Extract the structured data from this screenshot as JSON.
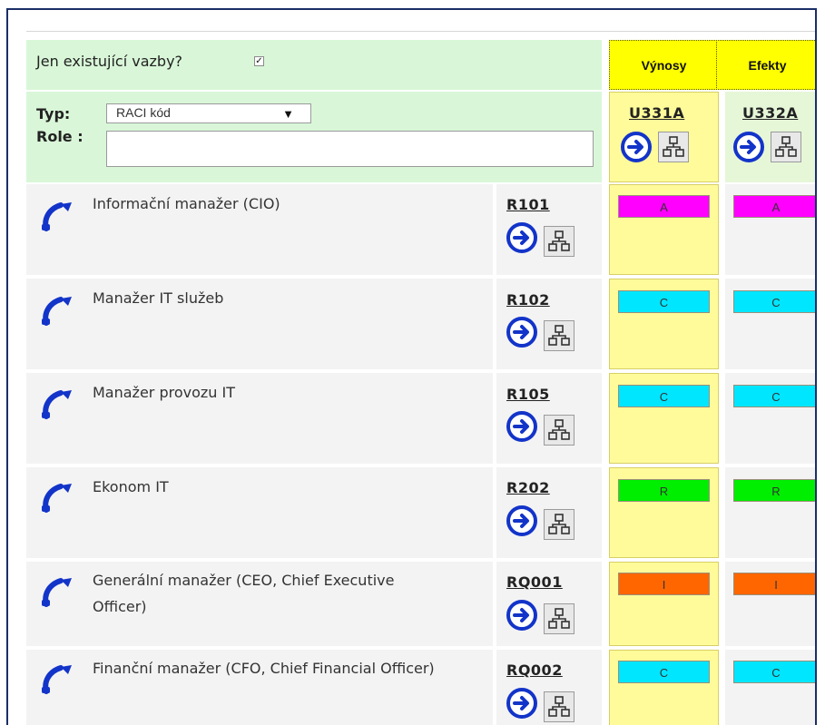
{
  "filter": {
    "existing_label": "Jen existující vazby?",
    "existing_checked": true,
    "type_label": "Typ:",
    "type_value": "RACI kód",
    "role_label": "Role :",
    "role_value": ""
  },
  "columns": [
    {
      "header": "Výnosy",
      "code": "U331A"
    },
    {
      "header": "Efekty",
      "code": "U332A"
    }
  ],
  "raci_colors": {
    "A": "#ff00ff",
    "C": "#00e6ff",
    "R": "#00ee00",
    "I": "#ff6600"
  },
  "rows": [
    {
      "name": "Informační manažer (CIO)",
      "code": "R101",
      "raci": [
        "A",
        "A"
      ]
    },
    {
      "name": "Manažer IT služeb",
      "code": "R102",
      "raci": [
        "C",
        "C"
      ]
    },
    {
      "name": "Manažer provozu IT",
      "code": "R105",
      "raci": [
        "C",
        "C"
      ]
    },
    {
      "name": "Ekonom IT",
      "code": "R202",
      "raci": [
        "R",
        "R"
      ]
    },
    {
      "name": "Generální manažer (CEO, Chief Executive Officer)",
      "code": "RQ001",
      "raci": [
        "I",
        "I"
      ]
    },
    {
      "name": "Finanční manažer (CFO, Chief Financial Officer)",
      "code": "RQ002",
      "raci": [
        "C",
        "C"
      ]
    }
  ]
}
